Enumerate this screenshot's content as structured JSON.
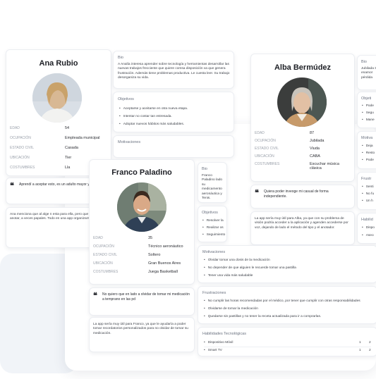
{
  "ana": {
    "name": "Ana Rubio",
    "fields": [
      {
        "k": "EDAD",
        "v": "54"
      },
      {
        "k": "OCUPACIÓN",
        "v": "Empleada municipal"
      },
      {
        "k": "ESTADO CIVIL",
        "v": "Casada"
      },
      {
        "k": "UBICACIÓN",
        "v": "Tier"
      },
      {
        "k": "COSTUMBRES",
        "v": "Lla"
      }
    ],
    "quote": "Aprendí a aceptar esto, es un adulto mayor y son r",
    "story": "Ana menciona que al alge n esta para ella, pero que n tiempo de anotar, a veces papales. Todo en una app organizarse",
    "bio_title": "Bio",
    "bio": "A Analía interesa aprender sobre tecnología y herramientas desarrollar las nuevas trabajos frecciente que quiere comsa disposición va que genera frustración. Además tiene problemas productiva. Le cuesta leer. Su trabajo desorganiza su vida.",
    "objetivos_title": "Objetivos",
    "objetivos": [
      "Aceptarse y aceitarse en otra nueva etapa.",
      "Intentar no costar tan estresada.",
      "Adoptar nuevos hábitos más saludables."
    ],
    "motivaciones_title": "Motivaciones"
  },
  "alba": {
    "name": "Alba Bermúdez",
    "fields": [
      {
        "k": "EDAD",
        "v": "87"
      },
      {
        "k": "OCUPACIÓN",
        "v": "Jubilada"
      },
      {
        "k": "ESTADO CIVIL",
        "v": "Viuda"
      },
      {
        "k": "UBICACIÓN",
        "v": "CABA"
      },
      {
        "k": "COSTUMBRES",
        "v": "Escuchar música clásica"
      }
    ],
    "quote": "Quiera poder inveoge mi casual de forma independiente.",
    "story": "La app sería muy útil para Alba, ya que con su problema de visión podría acceder a la aplicación y agenden accederse por voz, dejando de lado el método del tipo y el anotador.",
    "bio_title": "Bio",
    "bio": "Jubilada Si enamor pérdida",
    "objetivos_title": "Objeti",
    "objetivos": [
      "Pode",
      "Segu",
      "Mane"
    ],
    "motivaciones_title": "Motiva",
    "motivaciones": [
      "Deja",
      "Resto",
      "Pode"
    ],
    "frustraciones_title": "Frustr",
    "frustraciones": [
      "Senti",
      "No fu",
      "Un h"
    ],
    "habilidades_title": "Habilid",
    "habilidades": [
      "Dispo",
      "Aseo"
    ]
  },
  "franco": {
    "name": "Franco Paladino",
    "fields": [
      {
        "k": "EDAD",
        "v": "35"
      },
      {
        "k": "OCUPACIÓN",
        "v": "Técnico aeronáutico"
      },
      {
        "k": "ESTADO CIVIL",
        "v": "Soltero"
      },
      {
        "k": "UBICACIÓN",
        "v": "Gran Buenos Aires"
      },
      {
        "k": "COSTUMBRES",
        "v": "Juega Basketball"
      }
    ],
    "quote": "No quiero que en lado a olvidar de tomar mi medicación a temprano en las pd",
    "story": "La app sería muy útil para Franco, ya que le ayudaría a poder tomar recordatorios personalizados para no olvidar de tomar su medicación.",
    "bio_title": "Bio",
    "bio": "Franco Paladino lado su medicamento aeronáutica y Tenis.",
    "objetivos_title": "Objetivos",
    "objetivos": [
      "Resolver la",
      "Realizar os",
      "Seguimiento"
    ],
    "motivaciones_title": "Motivaciones",
    "motivaciones": [
      "Olvidar tomar una dosis de la medicación",
      "No depender de que alguien le recuerde tomar una pastilla",
      "Tener una vida más saludable"
    ],
    "frustraciones_title": "Frustraciones",
    "frustraciones": [
      "No cumplir las horas recomendadas por el médico, por tener que cumplir con otras responsabilidades",
      "Olvidarse de tomar la medicación",
      "Quedarse sin pastillas y no tener la receta actualizada para ir a comprarlas."
    ],
    "habilidades_title": "Habilidades Tecnológicas",
    "habilidades": [
      {
        "label": "Dispositivo Móvil",
        "a": "1",
        "b": "2"
      },
      {
        "label": "Smart TV",
        "a": "1",
        "b": "2"
      }
    ]
  }
}
